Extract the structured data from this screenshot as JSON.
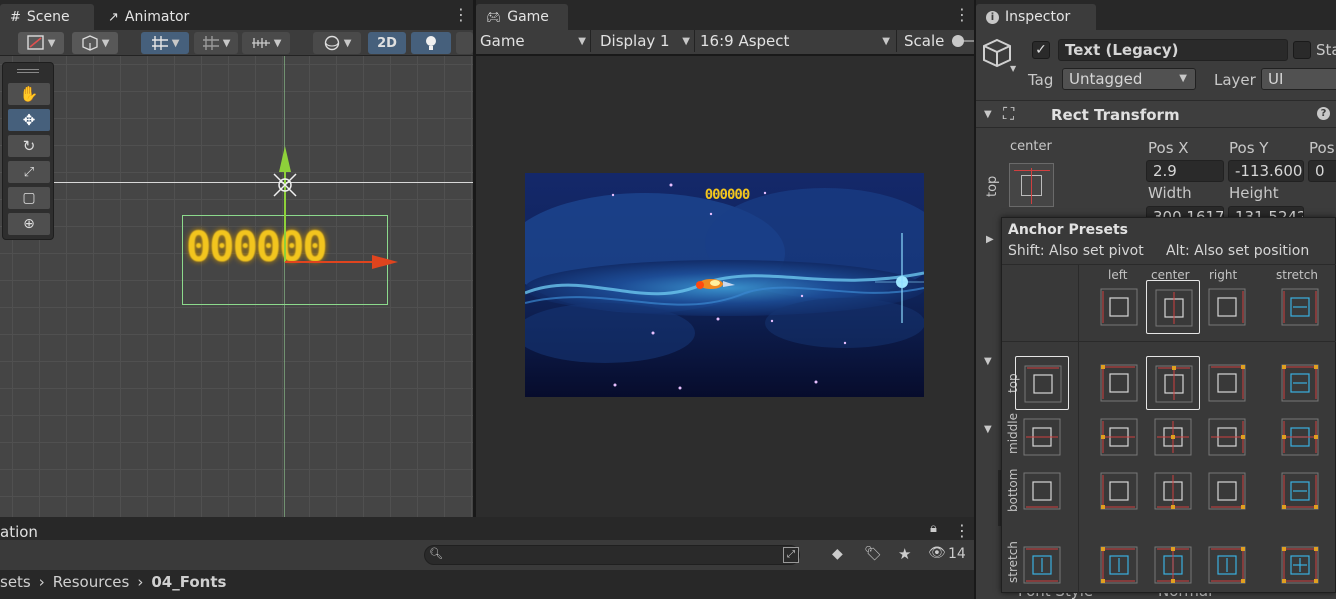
{
  "scene_panel": {
    "tabs": [
      {
        "label": "Scene",
        "icon": "grid-icon"
      },
      {
        "label": "Animator",
        "icon": "animator-icon"
      }
    ],
    "toolbar": {
      "mode_2d": "2D"
    },
    "object_text": "000000"
  },
  "game_panel": {
    "tab_label": "Game",
    "display_mode": "Game",
    "display": "Display 1",
    "aspect": "16:9 Aspect",
    "scale_label": "Scale",
    "hud_score": "000000"
  },
  "inspector": {
    "tab_label": "Inspector",
    "object_name": "Text (Legacy)",
    "static_label": "Sta",
    "tag_label": "Tag",
    "tag_value": "Untagged",
    "layer_label": "Layer",
    "layer_value": "UI",
    "rect_transform": {
      "title": "Rect Transform",
      "anchor_h": "center",
      "anchor_v": "top",
      "pos_x_label": "Pos X",
      "pos_x": "2.9",
      "pos_y_label": "Pos Y",
      "pos_y": "-113.600",
      "pos_z_label": "Pos",
      "pos_z": "0",
      "width_label": "Width",
      "width": "300.1617",
      "height_label": "Height",
      "height": "131.5242"
    },
    "bottom_cut_labels": {
      "font_style": "Font Style",
      "normal": "Normal"
    }
  },
  "anchor_presets": {
    "title": "Anchor Presets",
    "hint_shift": "Shift: Also set pivot",
    "hint_alt": "Alt: Also set position",
    "columns": [
      "left",
      "center",
      "right",
      "stretch"
    ],
    "rows": [
      "top",
      "middle",
      "bottom",
      "stretch"
    ]
  },
  "project_panel": {
    "tab_label": "ation",
    "breadcrumb": [
      "sets",
      "Resources",
      "04_Fonts"
    ],
    "hidden_count": "14"
  },
  "colors": {
    "accent_blue": "#46607c",
    "anchor_red": "#d04040",
    "anchor_blue": "#3ab0e0",
    "pivot_orange": "#e0a020",
    "score_yellow": "#f2c51e"
  }
}
